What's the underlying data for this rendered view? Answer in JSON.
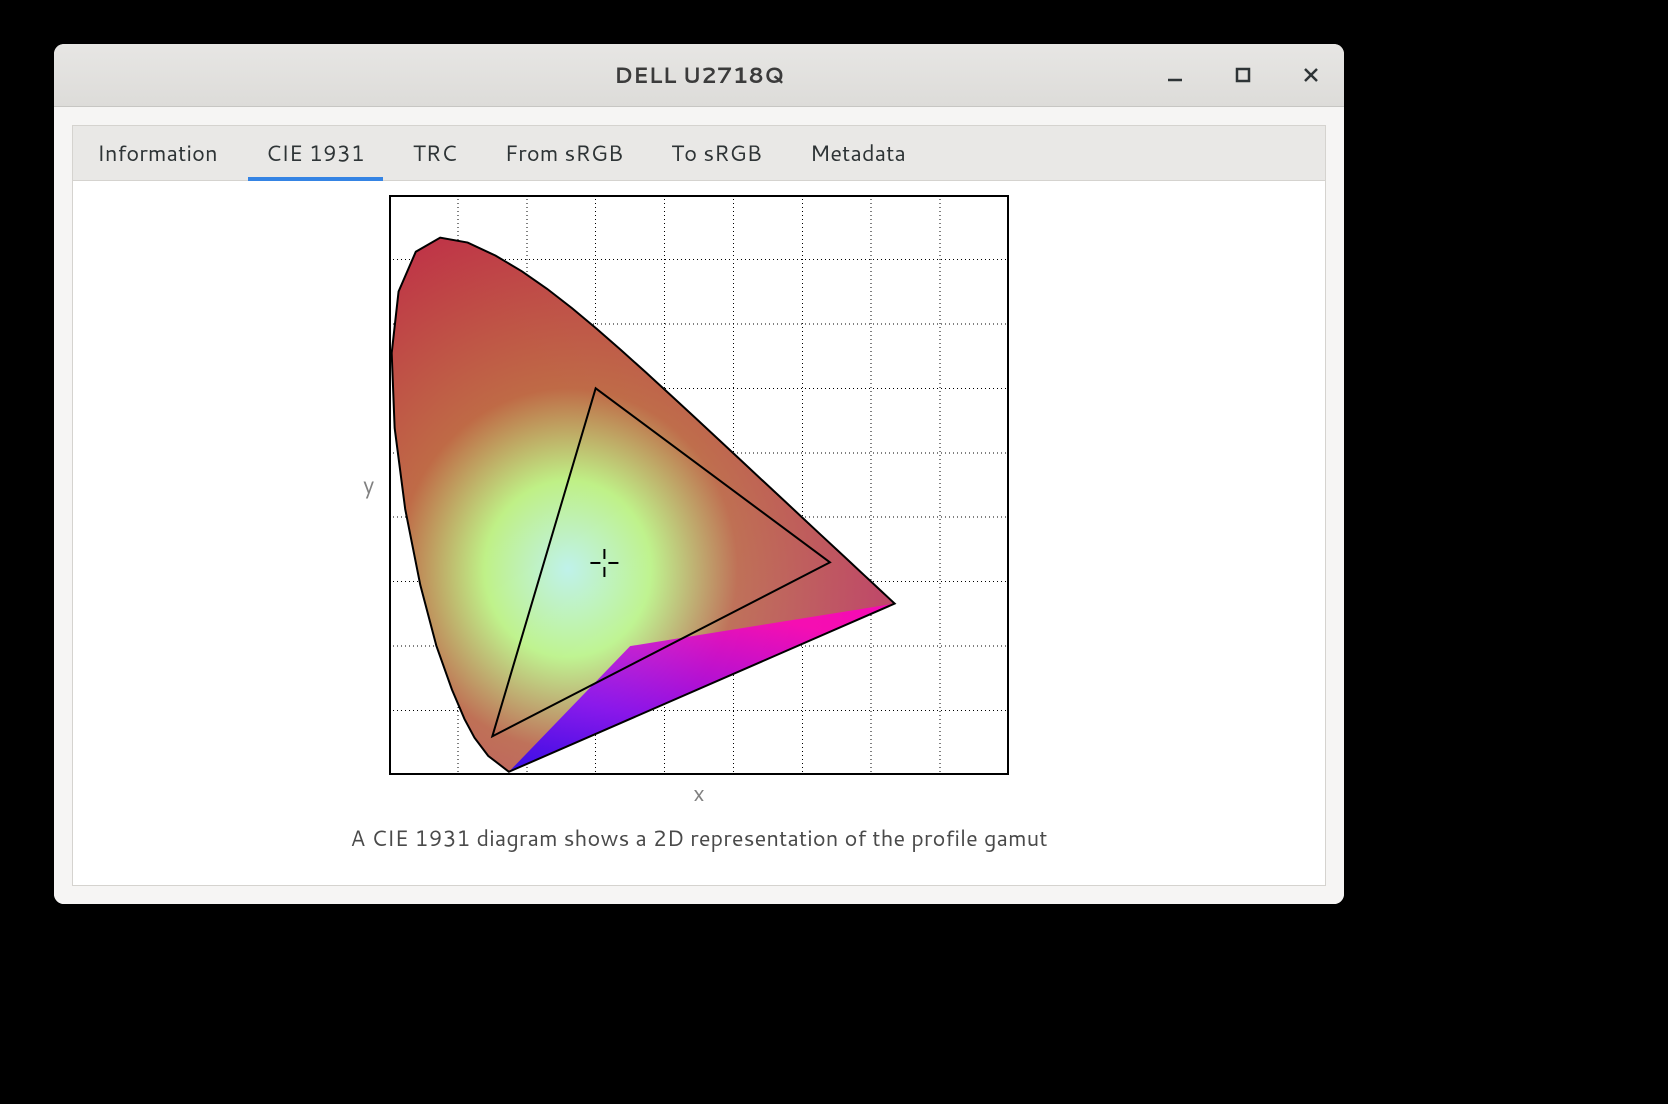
{
  "window": {
    "title": "DELL U2718Q"
  },
  "tabs": [
    {
      "label": "Information",
      "active": false
    },
    {
      "label": "CIE 1931",
      "active": true
    },
    {
      "label": "TRC",
      "active": false
    },
    {
      "label": "From sRGB",
      "active": false
    },
    {
      "label": "To sRGB",
      "active": false
    },
    {
      "label": "Metadata",
      "active": false
    }
  ],
  "chart": {
    "xlabel": "x",
    "ylabel": "y",
    "caption": "A CIE 1931 diagram shows a 2D representation of the profile gamut"
  },
  "chart_data": {
    "type": "cie1931",
    "title": "",
    "xlabel": "x",
    "ylabel": "y",
    "xlim": [
      0.0,
      0.9
    ],
    "ylim": [
      0.0,
      0.9
    ],
    "grid": true,
    "spectral_locus": [
      [
        0.1741,
        0.005
      ],
      [
        0.144,
        0.0297
      ],
      [
        0.1241,
        0.0578
      ],
      [
        0.1096,
        0.0868
      ],
      [
        0.0913,
        0.1327
      ],
      [
        0.0687,
        0.2007
      ],
      [
        0.0454,
        0.295
      ],
      [
        0.0235,
        0.4127
      ],
      [
        0.0082,
        0.5384
      ],
      [
        0.0039,
        0.6548
      ],
      [
        0.0139,
        0.7502
      ],
      [
        0.0389,
        0.812
      ],
      [
        0.0743,
        0.8338
      ],
      [
        0.1142,
        0.8262
      ],
      [
        0.1547,
        0.8059
      ],
      [
        0.1929,
        0.7816
      ],
      [
        0.2296,
        0.7543
      ],
      [
        0.2658,
        0.7243
      ],
      [
        0.3016,
        0.6923
      ],
      [
        0.3373,
        0.6589
      ],
      [
        0.3731,
        0.6245
      ],
      [
        0.4087,
        0.5896
      ],
      [
        0.4441,
        0.5547
      ],
      [
        0.4788,
        0.5202
      ],
      [
        0.5125,
        0.4866
      ],
      [
        0.5448,
        0.4544
      ],
      [
        0.5752,
        0.4242
      ],
      [
        0.6029,
        0.3965
      ],
      [
        0.627,
        0.3725
      ],
      [
        0.6482,
        0.3514
      ],
      [
        0.6658,
        0.334
      ],
      [
        0.6801,
        0.3197
      ],
      [
        0.6915,
        0.3083
      ],
      [
        0.7006,
        0.2993
      ],
      [
        0.714,
        0.2859
      ],
      [
        0.726,
        0.274
      ],
      [
        0.734,
        0.266
      ]
    ],
    "gamut_triangle": {
      "red": [
        0.64,
        0.33
      ],
      "green": [
        0.3,
        0.6
      ],
      "blue": [
        0.15,
        0.06
      ]
    },
    "white_point": [
      0.3127,
      0.329
    ]
  }
}
